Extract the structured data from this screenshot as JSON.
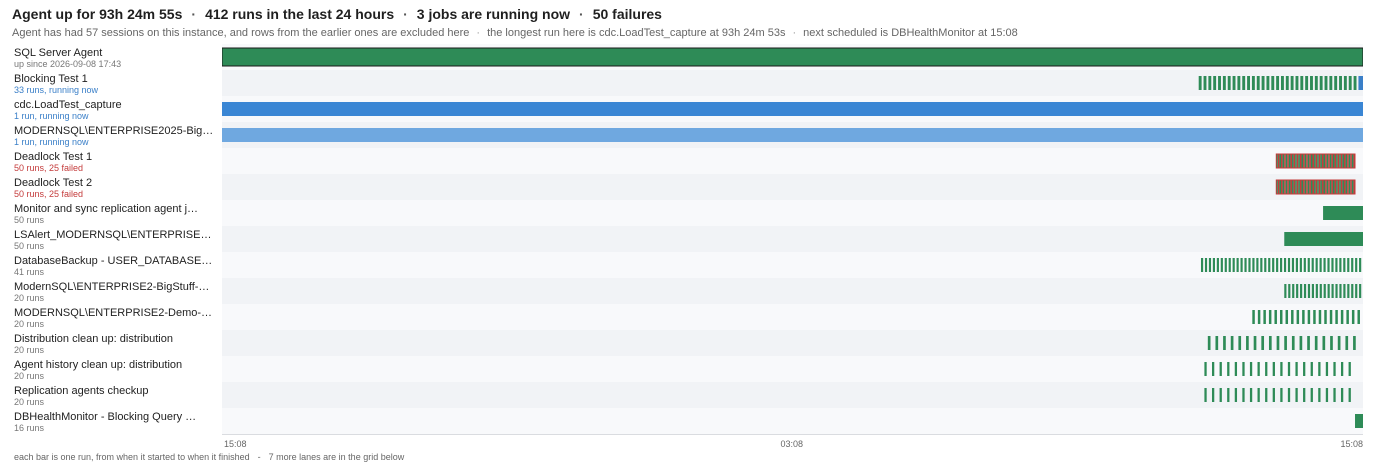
{
  "header": {
    "uptime": "Agent up  for 93h 24m 55s",
    "runs": "412 runs  in the last 24 hours",
    "jobs": "3 jobs are running now",
    "failures": "50 failures",
    "sessions_note": "Agent has had 57 sessions on this instance, and rows from the earlier ones are excluded here",
    "longest_note": "the longest run here is cdc.LoadTest_capture at 93h 24m 53s",
    "next_note": "next scheduled is DBHealthMonitor at 15:08"
  },
  "axis": {
    "ticks": [
      {
        "label": "15:08",
        "pos": 0
      },
      {
        "label": "03:08",
        "pos": 0.5
      },
      {
        "label": "15:08",
        "pos": 1
      }
    ]
  },
  "lanes": [
    {
      "name": "SQL Server Agent",
      "sub": "up since 2026-09-08 17:43",
      "sub_kind": "normal",
      "bars": [
        {
          "start": 0,
          "end": 1,
          "color": "#2e8b57",
          "outline": true
        }
      ]
    },
    {
      "name": "Blocking Test 1",
      "sub": "33 runs, running now",
      "sub_kind": "running",
      "bars": [
        {
          "pattern": "dense",
          "start": 0.856,
          "end": 0.996,
          "count": 33,
          "color": "#2e8b57",
          "fill": 0.6
        },
        {
          "start": 0.996,
          "end": 1,
          "color": "#3a7fc8"
        }
      ]
    },
    {
      "name": "cdc.LoadTest_capture",
      "sub": "1 run, running now",
      "sub_kind": "running",
      "bars": [
        {
          "start": 0,
          "end": 1,
          "color": "#3a86d4"
        }
      ]
    },
    {
      "name": "MODERNSQL\\ENTERPRISE2025-Big…",
      "sub": "1 run, running now",
      "sub_kind": "running",
      "bars": [
        {
          "start": 0,
          "end": 1,
          "color": "#6fa8e0"
        }
      ]
    },
    {
      "name": "Deadlock Test 1",
      "sub": "50 runs, 25 failed",
      "sub_kind": "failed",
      "bars": [
        {
          "pattern": "alt",
          "start": 0.924,
          "end": 0.993,
          "count": 50,
          "color": "#2e8b57",
          "color2": "#c43b3b",
          "outline": true
        }
      ]
    },
    {
      "name": "Deadlock Test 2",
      "sub": "50 runs, 25 failed",
      "sub_kind": "failed",
      "bars": [
        {
          "pattern": "alt",
          "start": 0.924,
          "end": 0.993,
          "count": 50,
          "color": "#2e8b57",
          "color2": "#c43b3b",
          "outline": true
        }
      ]
    },
    {
      "name": "Monitor and sync replication agent j…",
      "sub": "50 runs",
      "sub_kind": "normal",
      "bars": [
        {
          "start": 0.965,
          "end": 1,
          "color": "#2e8b57"
        }
      ]
    },
    {
      "name": "LSAlert_MODERNSQL\\ENTERPRISE2…",
      "sub": "50 runs",
      "sub_kind": "normal",
      "bars": [
        {
          "start": 0.931,
          "end": 1,
          "color": "#2e8b57"
        }
      ]
    },
    {
      "name": "DatabaseBackup - USER_DATABASE…",
      "sub": "41 runs",
      "sub_kind": "normal",
      "bars": [
        {
          "pattern": "dense",
          "start": 0.858,
          "end": 1,
          "count": 41,
          "color": "#2e8b57",
          "fill": 0.55
        }
      ]
    },
    {
      "name": "ModernSQL\\ENTERPRISE2-BigStuff-…",
      "sub": "20 runs",
      "sub_kind": "normal",
      "bars": [
        {
          "pattern": "dense",
          "start": 0.931,
          "end": 1,
          "count": 20,
          "color": "#2e8b57",
          "fill": 0.55
        }
      ]
    },
    {
      "name": "MODERNSQL\\ENTERPRISE2-Demo-…",
      "sub": "20 runs",
      "sub_kind": "normal",
      "bars": [
        {
          "pattern": "dense",
          "start": 0.903,
          "end": 1,
          "count": 20,
          "color": "#2e8b57",
          "fill": 0.45
        }
      ]
    },
    {
      "name": "Distribution clean up: distribution",
      "sub": "20 runs",
      "sub_kind": "normal",
      "bars": [
        {
          "pattern": "dense",
          "start": 0.864,
          "end": 0.998,
          "count": 20,
          "color": "#2e8b57",
          "fill": 0.35
        }
      ]
    },
    {
      "name": "Agent history clean up: distribution",
      "sub": "20 runs",
      "sub_kind": "normal",
      "bars": [
        {
          "pattern": "dense",
          "start": 0.861,
          "end": 0.994,
          "count": 20,
          "color": "#2e8b57",
          "fill": 0.3
        }
      ]
    },
    {
      "name": "Replication agents checkup",
      "sub": "20 runs",
      "sub_kind": "normal",
      "bars": [
        {
          "pattern": "dense",
          "start": 0.861,
          "end": 0.994,
          "count": 20,
          "color": "#2e8b57",
          "fill": 0.3
        }
      ]
    },
    {
      "name": "DBHealthMonitor - Blocking Query …",
      "sub": "16 runs",
      "sub_kind": "normal",
      "bars": [
        {
          "start": 0.993,
          "end": 1,
          "color": "#2e8b57"
        }
      ]
    }
  ],
  "footer": {
    "legend": "each bar is one run, from when it started to when it finished",
    "more": "7 more lanes are in the grid below"
  }
}
